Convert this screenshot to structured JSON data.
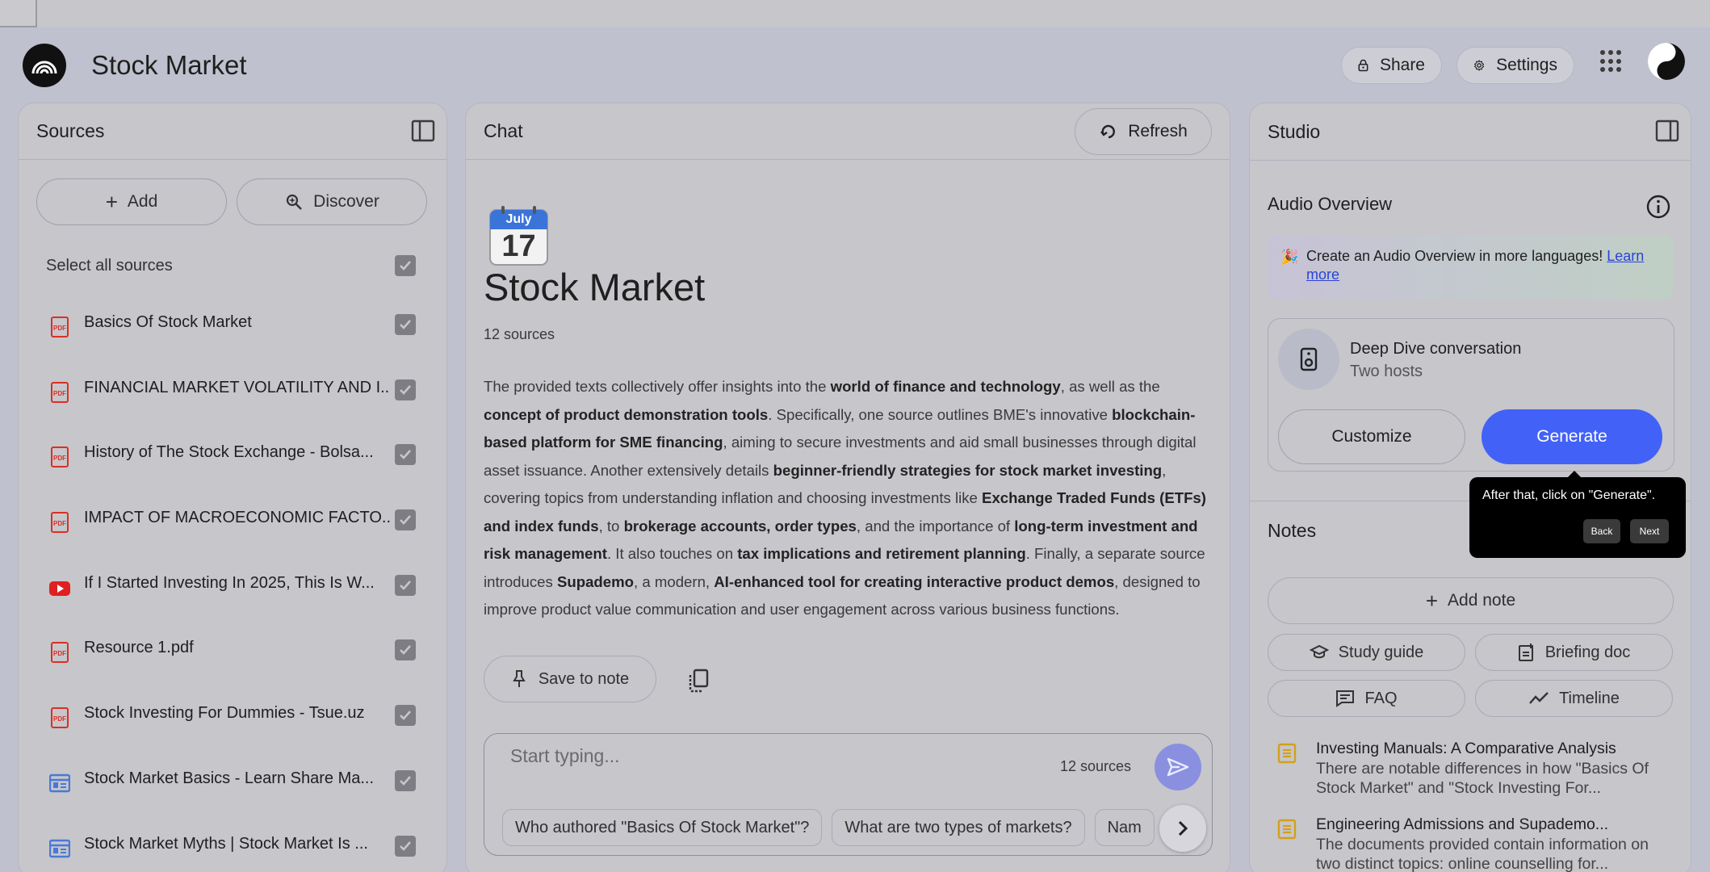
{
  "app": {
    "title": "Stock Market",
    "share_label": "Share",
    "settings_label": "Settings"
  },
  "sources": {
    "title": "Sources",
    "add_label": "Add",
    "discover_label": "Discover",
    "select_all_label": "Select all sources",
    "items": [
      {
        "label": "Basics Of Stock Market",
        "type": "pdf"
      },
      {
        "label": "FINANCIAL MARKET VOLATILITY AND I...",
        "type": "pdf"
      },
      {
        "label": "History of The Stock Exchange - Bolsa...",
        "type": "pdf"
      },
      {
        "label": "IMPACT OF MACROECONOMIC FACTO...",
        "type": "pdf"
      },
      {
        "label": "If I Started Investing In 2025, This Is W...",
        "type": "youtube"
      },
      {
        "label": "Resource 1.pdf",
        "type": "pdf"
      },
      {
        "label": "Stock Investing For Dummies - Tsue.uz",
        "type": "pdf"
      },
      {
        "label": "Stock Market Basics - Learn Share Ma...",
        "type": "web"
      },
      {
        "label": "Stock Market Myths | Stock Market Is ...",
        "type": "web"
      }
    ]
  },
  "chat": {
    "title": "Chat",
    "refresh_label": "Refresh",
    "calendar_month": "July",
    "calendar_day": "17",
    "notebook_title": "Stock Market",
    "source_count": "12 sources",
    "summary_segments": [
      {
        "t": "The provided texts collectively offer insights into the ",
        "b": false
      },
      {
        "t": "world of finance and technology",
        "b": true
      },
      {
        "t": ", as well as the ",
        "b": false
      },
      {
        "t": "concept of product demonstration tools",
        "b": true
      },
      {
        "t": ". Specifically, one source outlines BME's innovative ",
        "b": false
      },
      {
        "t": "blockchain-based platform for SME financing",
        "b": true
      },
      {
        "t": ", aiming to secure investments and aid small businesses through digital asset issuance. Another extensively details ",
        "b": false
      },
      {
        "t": "beginner-friendly strategies for stock market investing",
        "b": true
      },
      {
        "t": ", covering topics from understanding inflation and choosing investments like ",
        "b": false
      },
      {
        "t": "Exchange Traded Funds (ETFs) and index funds",
        "b": true
      },
      {
        "t": ", to ",
        "b": false
      },
      {
        "t": "brokerage accounts, order types",
        "b": true
      },
      {
        "t": ", and the importance of ",
        "b": false
      },
      {
        "t": "long-term investment and risk management",
        "b": true
      },
      {
        "t": ". It also touches on ",
        "b": false
      },
      {
        "t": "tax implications and retirement planning",
        "b": true
      },
      {
        "t": ". Finally, a separate source introduces ",
        "b": false
      },
      {
        "t": "Supademo",
        "b": true
      },
      {
        "t": ", a modern, ",
        "b": false
      },
      {
        "t": "AI-enhanced tool for creating interactive product demos",
        "b": true
      },
      {
        "t": ", designed to improve product value communication and user engagement across various business functions.",
        "b": false
      }
    ],
    "save_to_note_label": "Save to note",
    "input_placeholder": "Start typing...",
    "input_source_count": "12 sources",
    "suggestions": [
      "Who authored \"Basics Of Stock Market\"?",
      "What are two types of markets?",
      "Nam"
    ]
  },
  "studio": {
    "title": "Studio",
    "audio_overview_title": "Audio Overview",
    "banner_text": "Create an Audio Overview in more languages!",
    "banner_link": "Learn more",
    "deep_dive_title": "Deep Dive conversation",
    "deep_dive_subtitle": "Two hosts",
    "customize_label": "Customize",
    "generate_label": "Generate",
    "notes_title": "Notes",
    "add_note_label": "Add note",
    "tools": [
      {
        "label": "Study guide",
        "icon": "graduation-cap-icon"
      },
      {
        "label": "Briefing doc",
        "icon": "document-add-icon"
      },
      {
        "label": "FAQ",
        "icon": "chat-icon"
      },
      {
        "label": "Timeline",
        "icon": "trending-icon"
      }
    ],
    "notes": [
      {
        "title": "Investing Manuals: A Comparative Analysis",
        "body": "There are notable differences in how \"Basics Of Stock Market\" and \"Stock Investing For..."
      },
      {
        "title": "Engineering Admissions and Supademo...",
        "body": "The documents provided contain information on two distinct topics: online counselling for..."
      }
    ]
  },
  "tooltip": {
    "text": "After that, click on \"Generate\".",
    "back_label": "Back",
    "next_label": "Next"
  },
  "colors": {
    "background": "#c0c1ce",
    "accent": "#4262f7",
    "pdf_red": "#d93025",
    "web_blue": "#4a78d8"
  }
}
